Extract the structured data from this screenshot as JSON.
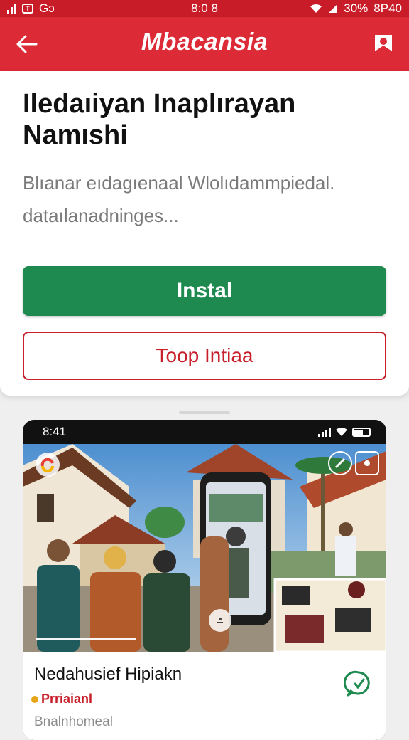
{
  "status_bar": {
    "left_label": "Gↄ",
    "box_icon_label": "T",
    "time": "8:0 8",
    "battery_text": "30%",
    "extra_text": "8P40",
    "icons": [
      "signal-icon",
      "wifi-icon",
      "battery-icon"
    ]
  },
  "app_bar": {
    "brand": "Mbacansia",
    "back_icon": "arrow-left-icon",
    "flag_icon": "bookmark-flag-icon",
    "color": "#dc2a36"
  },
  "promo": {
    "title": "Iledaıiyan Inaplırayan Namıshi",
    "description": "Blıanar eıdagıenaal Wlolıdammpiedal. dataılanadninges...",
    "install_label": "Instal",
    "secondary_label": "Toop Intiaa",
    "install_color": "#1e8a50",
    "secondary_color": "#c8202b"
  },
  "preview": {
    "phone_time": "8:41",
    "news_title": "Nedahusief Hipiakn",
    "badge": "Prriaianl",
    "meta": "Bnalnhomeal",
    "chat_icon": "whatsapp-chat-icon"
  }
}
